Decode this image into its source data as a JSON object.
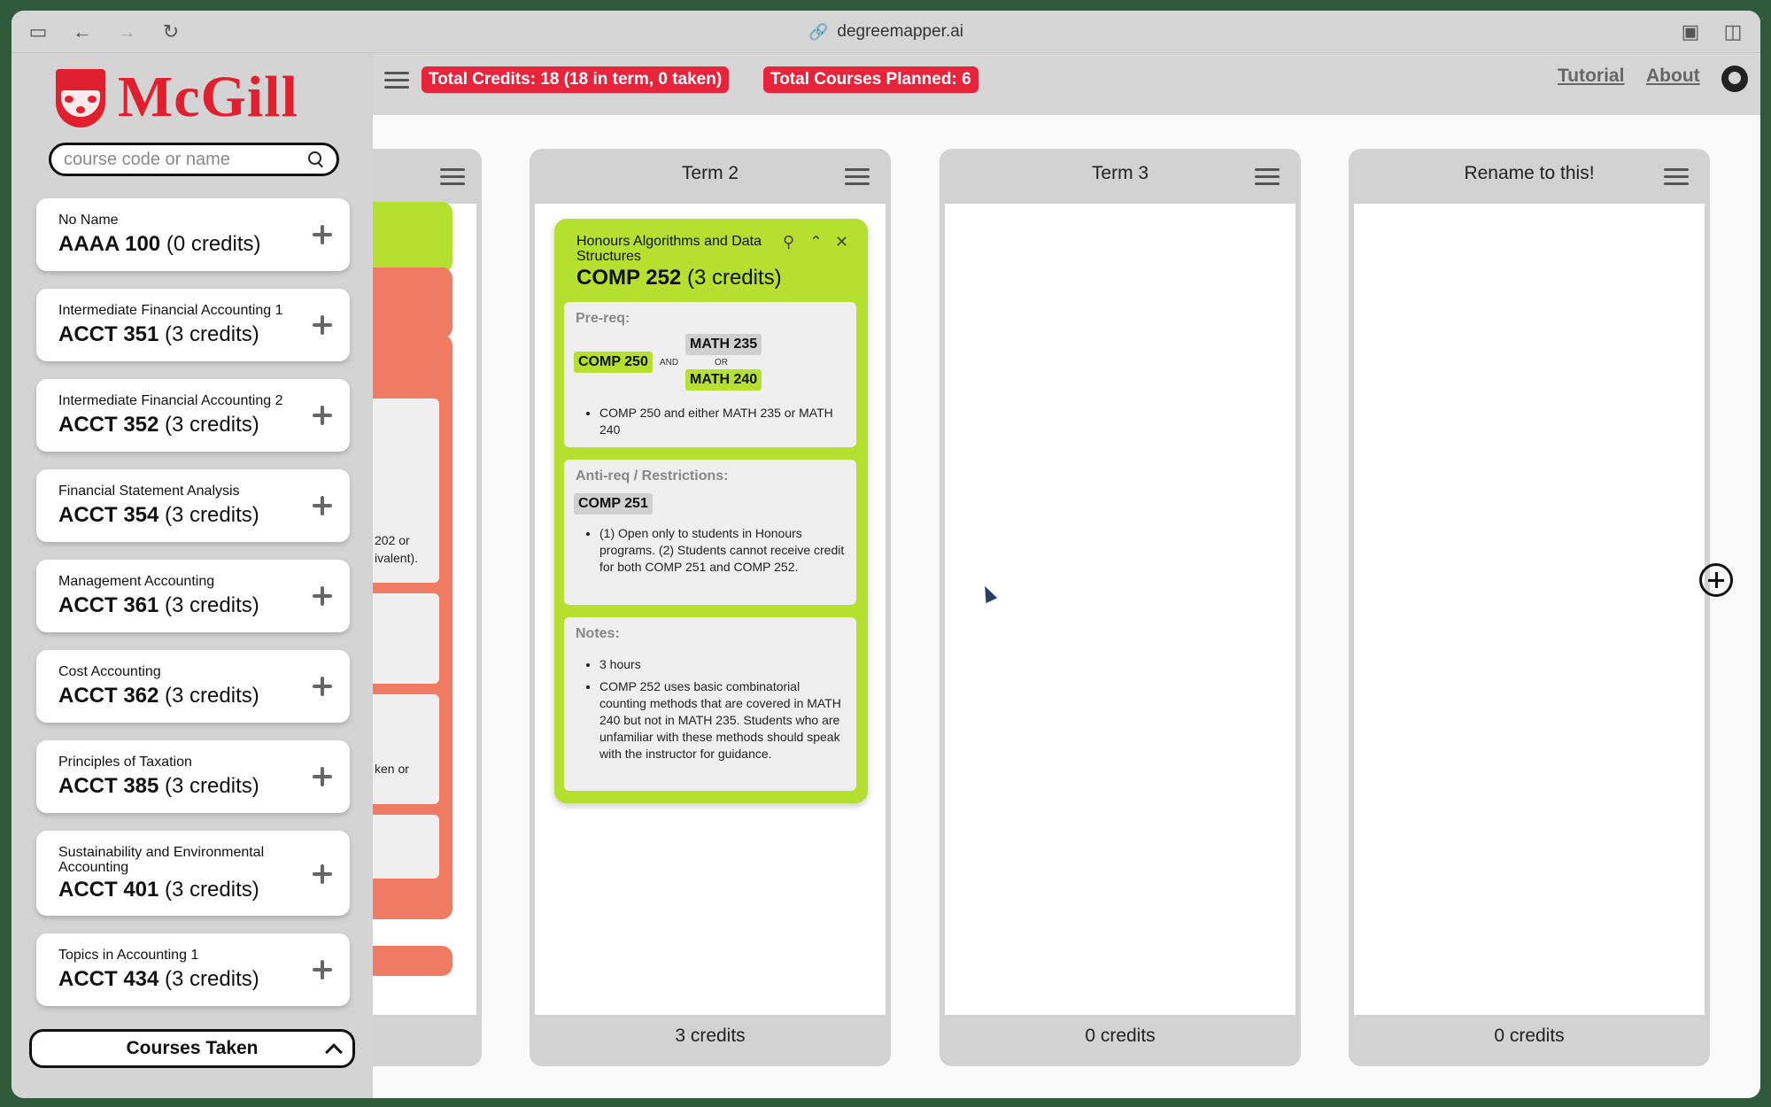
{
  "browser": {
    "url": "degreemapper.ai"
  },
  "header": {
    "total_credits": "Total Credits: 18 (18 in term, 0 taken)",
    "total_courses": "Total Courses Planned: 6",
    "tutorial": "Tutorial",
    "about": "About"
  },
  "sidebar": {
    "logo_text": "McGill",
    "search_placeholder": "course code or name",
    "courses_taken": "Courses Taken",
    "courses": [
      {
        "name": "No Name",
        "code": "AAAA 100",
        "credits": "(0 credits)"
      },
      {
        "name": "Intermediate Financial Accounting 1",
        "code": "ACCT 351",
        "credits": "(3 credits)"
      },
      {
        "name": "Intermediate Financial Accounting 2",
        "code": "ACCT 352",
        "credits": "(3 credits)"
      },
      {
        "name": "Financial Statement Analysis",
        "code": "ACCT 354",
        "credits": "(3 credits)"
      },
      {
        "name": "Management Accounting",
        "code": "ACCT 361",
        "credits": "(3 credits)"
      },
      {
        "name": "Cost Accounting",
        "code": "ACCT 362",
        "credits": "(3 credits)"
      },
      {
        "name": "Principles of Taxation",
        "code": "ACCT 385",
        "credits": "(3 credits)"
      },
      {
        "name": "Sustainability and Environmental Accounting",
        "code": "ACCT 401",
        "credits": "(3 credits)"
      },
      {
        "name": "Topics in Accounting 1",
        "code": "ACCT 434",
        "credits": "(3 credits)"
      }
    ]
  },
  "term1_partial": {
    "text1": "202 or",
    "text2": "ivalent).",
    "text3": "ken or"
  },
  "terms": [
    {
      "title": "Term 2",
      "footer": "3 credits"
    },
    {
      "title": "Term 3",
      "footer": "0 credits"
    },
    {
      "title": "Rename to this!",
      "footer": "0 credits"
    }
  ],
  "course_card": {
    "title": "Honours Algorithms and Data Structures",
    "code": "COMP 252",
    "credits": "(3 credits)",
    "prereq_heading": "Pre-req:",
    "prereq_a": "COMP 250",
    "and": "AND",
    "prereq_b": "MATH 235",
    "or": "OR",
    "prereq_c": "MATH 240",
    "prereq_note": "COMP 250 and either MATH 235 or MATH 240",
    "anti_heading": "Anti-req / Restrictions:",
    "anti_course": "COMP 251",
    "anti_note": "(1) Open only to students in Honours programs. (2) Students cannot receive credit for both COMP 251 and COMP 252.",
    "notes_heading": "Notes:",
    "note1": "3 hours",
    "note2": "COMP 252 uses basic combinatorial counting methods that are covered in MATH 240 but not in MATH 235. Students who are unfamiliar with these methods should speak with the instructor for guidance."
  }
}
